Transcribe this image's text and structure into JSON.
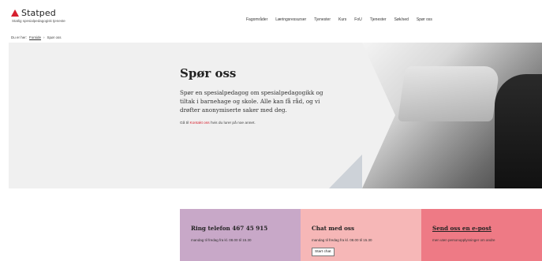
{
  "brand": {
    "name": "Statped",
    "subtitle": "Statlig spesialpedagogisk tjeneste",
    "logo_color": "#d6202f"
  },
  "nav": {
    "items": [
      "Fagområder",
      "Læringsressurser",
      "Tjenester",
      "Kurs",
      "FoU",
      "Tjenester",
      "Søk/sed",
      "Spør oss"
    ]
  },
  "breadcrumb": {
    "prefix": "Du er her:",
    "home": "Forside",
    "separator": "›",
    "current": "Spør oss"
  },
  "hero": {
    "title": "Spør oss",
    "lead": "Spør en spesialpedagog om spesialpedagogikk og tiltak i barnehage og skole. Alle kan få råd, og vi drøfter anonymiserte saker med deg.",
    "note_before": "Gå til",
    "note_link": "Kontakt oss",
    "note_after": "hvis du lurer på noe annet.",
    "background": "#f0f0f0"
  },
  "cards": {
    "phone": {
      "title": "Ring telefon 467 45 915",
      "text": "mandag til fredag fra kl. 08.00 til 15.30",
      "color": "#c8a8c8"
    },
    "chat": {
      "title": "Chat med oss",
      "text": "mandag til fredag fra kl. 08.00 til 15.30",
      "button": "Start chat",
      "color": "#f6b7b7"
    },
    "email": {
      "title": "Send oss en e-post",
      "text": "men uten personopplysninger om andre",
      "color": "#ee7a85"
    }
  }
}
